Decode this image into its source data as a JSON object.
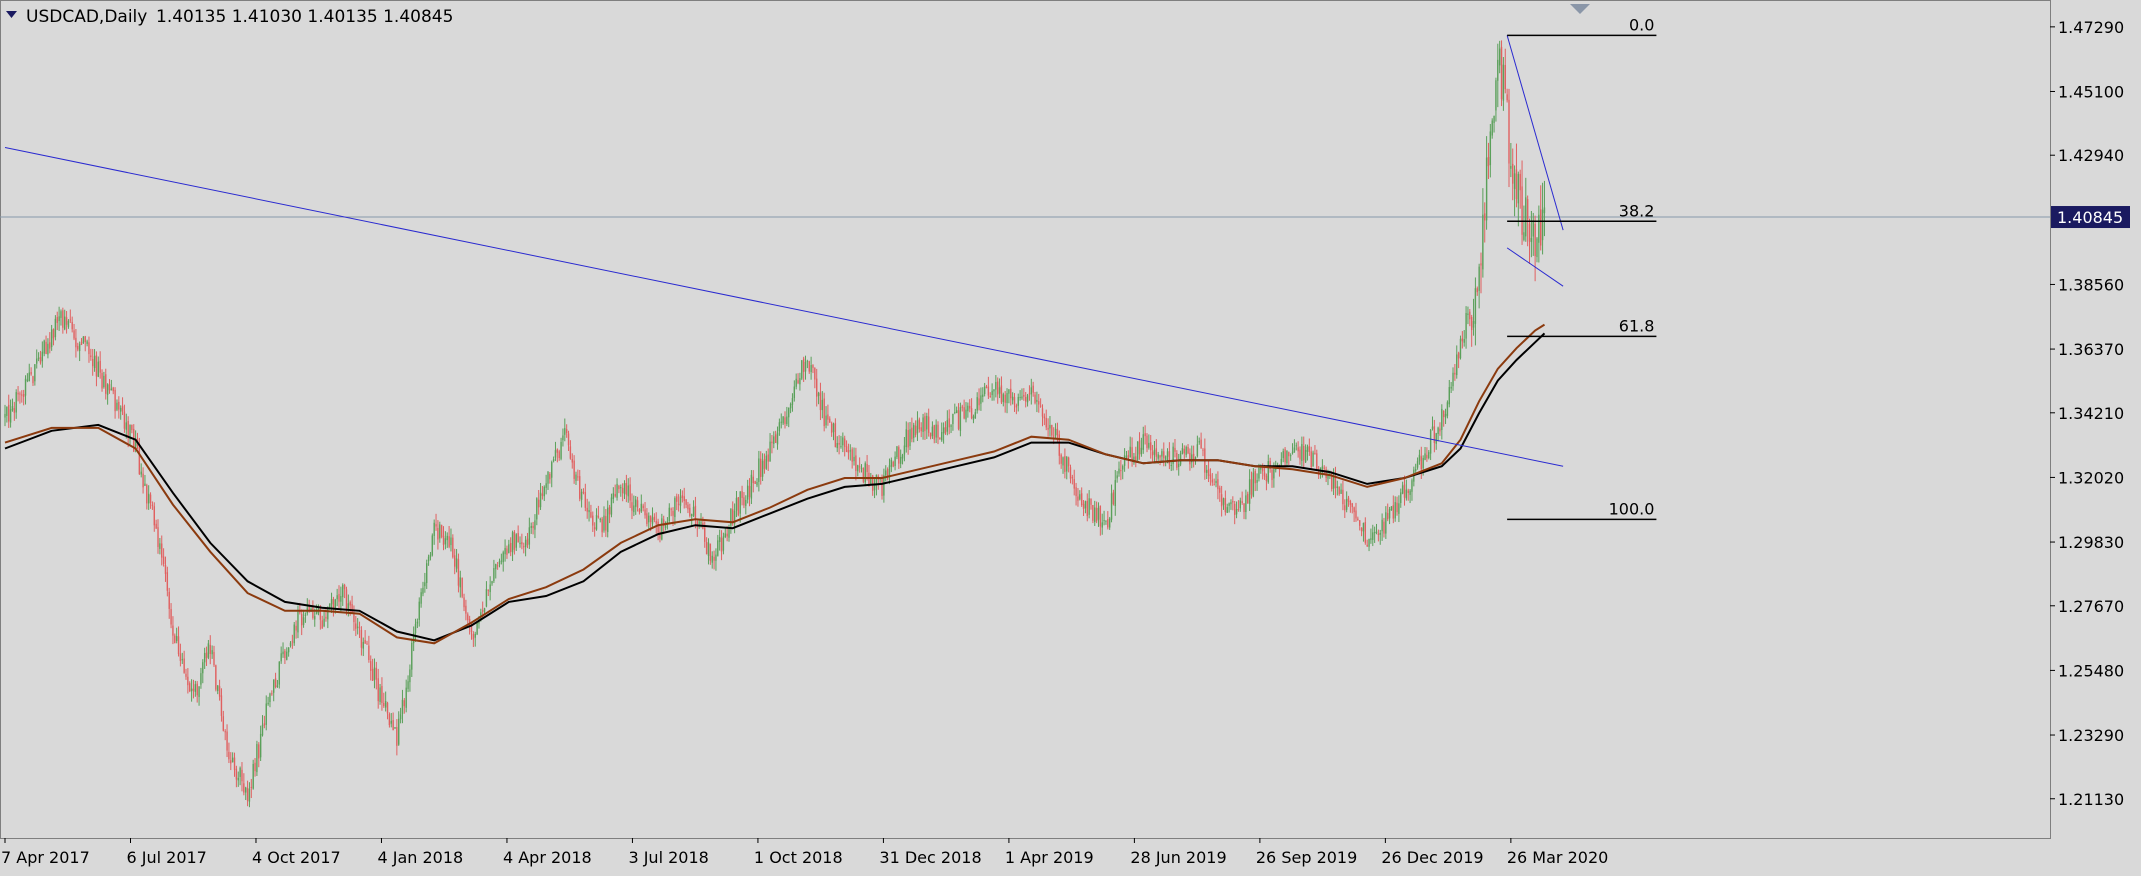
{
  "header": {
    "symbol": "USDCAD,Daily",
    "ohlc": "1.40135 1.41030 1.40135 1.40845"
  },
  "colors": {
    "background": "#d9d9d9",
    "bull": "#5aa05a",
    "bear": "#e06060",
    "ma_fast": "#000000",
    "ma_slow": "#8b3a0e",
    "trendline": "#2a2ad0",
    "fib_line": "#000000",
    "price_line": "#8899aa",
    "price_tag_bg": "#1a1a60",
    "price_tag_text": "#ffffff"
  },
  "current_price": {
    "value": 1.40845,
    "label": "1.40845"
  },
  "chart_data": {
    "type": "candlestick",
    "grid": false,
    "y_axis": {
      "range": [
        1.198,
        1.482
      ],
      "ticks": [
        "1.47290",
        "1.45100",
        "1.42940",
        "1.40845",
        "1.38560",
        "1.36370",
        "1.34210",
        "1.32020",
        "1.29830",
        "1.27670",
        "1.25480",
        "1.23290",
        "1.21130"
      ]
    },
    "x_axis": {
      "labels": [
        "7 Apr 2017",
        "6 Jul 2017",
        "4 Oct 2017",
        "4 Jan 2018",
        "4 Apr 2018",
        "3 Jul 2018",
        "1 Oct 2018",
        "31 Dec 2018",
        "1 Apr 2019",
        "28 Jun 2019",
        "26 Sep 2019",
        "26 Dec 2019",
        "26 Mar 2020"
      ]
    },
    "price_path": [
      [
        0,
        1.34
      ],
      [
        3,
        1.355
      ],
      [
        6,
        1.375
      ],
      [
        9,
        1.362
      ],
      [
        12,
        1.345
      ],
      [
        14,
        1.33
      ],
      [
        16,
        1.305
      ],
      [
        18,
        1.27
      ],
      [
        20,
        1.245
      ],
      [
        22,
        1.262
      ],
      [
        24,
        1.228
      ],
      [
        26,
        1.212
      ],
      [
        28,
        1.24
      ],
      [
        30,
        1.262
      ],
      [
        32,
        1.275
      ],
      [
        34,
        1.272
      ],
      [
        36,
        1.282
      ],
      [
        38,
        1.268
      ],
      [
        40,
        1.248
      ],
      [
        42,
        1.232
      ],
      [
        44,
        1.268
      ],
      [
        46,
        1.305
      ],
      [
        48,
        1.295
      ],
      [
        50,
        1.265
      ],
      [
        52,
        1.285
      ],
      [
        54,
        1.298
      ],
      [
        56,
        1.3
      ],
      [
        58,
        1.32
      ],
      [
        60,
        1.335
      ],
      [
        62,
        1.312
      ],
      [
        64,
        1.302
      ],
      [
        66,
        1.318
      ],
      [
        68,
        1.308
      ],
      [
        70,
        1.302
      ],
      [
        72,
        1.313
      ],
      [
        74,
        1.306
      ],
      [
        76,
        1.292
      ],
      [
        78,
        1.308
      ],
      [
        80,
        1.318
      ],
      [
        82,
        1.33
      ],
      [
        84,
        1.345
      ],
      [
        86,
        1.362
      ],
      [
        88,
        1.338
      ],
      [
        90,
        1.33
      ],
      [
        92,
        1.322
      ],
      [
        94,
        1.316
      ],
      [
        96,
        1.33
      ],
      [
        98,
        1.34
      ],
      [
        100,
        1.335
      ],
      [
        102,
        1.34
      ],
      [
        104,
        1.345
      ],
      [
        106,
        1.352
      ],
      [
        108,
        1.345
      ],
      [
        110,
        1.35
      ],
      [
        112,
        1.338
      ],
      [
        114,
        1.322
      ],
      [
        116,
        1.31
      ],
      [
        118,
        1.305
      ],
      [
        120,
        1.326
      ],
      [
        122,
        1.332
      ],
      [
        124,
        1.328
      ],
      [
        126,
        1.326
      ],
      [
        128,
        1.33
      ],
      [
        130,
        1.315
      ],
      [
        132,
        1.307
      ],
      [
        134,
        1.32
      ],
      [
        136,
        1.323
      ],
      [
        138,
        1.33
      ],
      [
        140,
        1.326
      ],
      [
        142,
        1.32
      ],
      [
        144,
        1.31
      ],
      [
        146,
        1.3
      ],
      [
        148,
        1.305
      ],
      [
        150,
        1.315
      ],
      [
        152,
        1.328
      ],
      [
        154,
        1.34
      ],
      [
        156,
        1.365
      ],
      [
        158,
        1.39
      ],
      [
        159,
        1.43
      ],
      [
        160,
        1.465
      ],
      [
        161,
        1.44
      ],
      [
        162,
        1.42
      ],
      [
        163,
        1.408
      ],
      [
        164,
        1.395
      ],
      [
        165,
        1.408
      ]
    ],
    "moving_averages": [
      {
        "color": "#000000",
        "points": [
          [
            0,
            1.33
          ],
          [
            5,
            1.336
          ],
          [
            10,
            1.338
          ],
          [
            14,
            1.333
          ],
          [
            18,
            1.315
          ],
          [
            22,
            1.298
          ],
          [
            26,
            1.285
          ],
          [
            30,
            1.278
          ],
          [
            34,
            1.276
          ],
          [
            38,
            1.275
          ],
          [
            42,
            1.268
          ],
          [
            46,
            1.265
          ],
          [
            50,
            1.27
          ],
          [
            54,
            1.278
          ],
          [
            58,
            1.28
          ],
          [
            62,
            1.285
          ],
          [
            66,
            1.295
          ],
          [
            70,
            1.301
          ],
          [
            74,
            1.304
          ],
          [
            78,
            1.303
          ],
          [
            82,
            1.308
          ],
          [
            86,
            1.313
          ],
          [
            90,
            1.317
          ],
          [
            94,
            1.318
          ],
          [
            98,
            1.321
          ],
          [
            102,
            1.324
          ],
          [
            106,
            1.327
          ],
          [
            110,
            1.332
          ],
          [
            114,
            1.332
          ],
          [
            118,
            1.328
          ],
          [
            122,
            1.325
          ],
          [
            126,
            1.326
          ],
          [
            130,
            1.326
          ],
          [
            134,
            1.324
          ],
          [
            138,
            1.324
          ],
          [
            142,
            1.322
          ],
          [
            146,
            1.318
          ],
          [
            150,
            1.32
          ],
          [
            154,
            1.324
          ],
          [
            156,
            1.33
          ],
          [
            158,
            1.342
          ],
          [
            160,
            1.353
          ],
          [
            162,
            1.36
          ],
          [
            164,
            1.366
          ],
          [
            165,
            1.369
          ]
        ]
      },
      {
        "color": "#8b3a0e",
        "points": [
          [
            0,
            1.332
          ],
          [
            5,
            1.337
          ],
          [
            10,
            1.337
          ],
          [
            14,
            1.33
          ],
          [
            18,
            1.311
          ],
          [
            22,
            1.295
          ],
          [
            26,
            1.281
          ],
          [
            30,
            1.275
          ],
          [
            34,
            1.275
          ],
          [
            38,
            1.274
          ],
          [
            42,
            1.266
          ],
          [
            46,
            1.264
          ],
          [
            50,
            1.271
          ],
          [
            54,
            1.279
          ],
          [
            58,
            1.283
          ],
          [
            62,
            1.289
          ],
          [
            66,
            1.298
          ],
          [
            70,
            1.304
          ],
          [
            74,
            1.306
          ],
          [
            78,
            1.305
          ],
          [
            82,
            1.31
          ],
          [
            86,
            1.316
          ],
          [
            90,
            1.32
          ],
          [
            94,
            1.32
          ],
          [
            98,
            1.323
          ],
          [
            102,
            1.326
          ],
          [
            106,
            1.329
          ],
          [
            110,
            1.334
          ],
          [
            114,
            1.333
          ],
          [
            118,
            1.328
          ],
          [
            122,
            1.325
          ],
          [
            126,
            1.326
          ],
          [
            130,
            1.326
          ],
          [
            134,
            1.324
          ],
          [
            138,
            1.323
          ],
          [
            142,
            1.321
          ],
          [
            146,
            1.317
          ],
          [
            150,
            1.32
          ],
          [
            154,
            1.325
          ],
          [
            156,
            1.333
          ],
          [
            158,
            1.346
          ],
          [
            160,
            1.357
          ],
          [
            162,
            1.364
          ],
          [
            164,
            1.37
          ],
          [
            165,
            1.372
          ]
        ]
      }
    ],
    "trendlines": [
      {
        "from": [
          0,
          1.432
        ],
        "to": [
          167,
          1.324
        ]
      },
      {
        "from": [
          161,
          1.47
        ],
        "to": [
          167,
          1.404
        ]
      },
      {
        "from": [
          161,
          1.398
        ],
        "to": [
          167,
          1.385
        ]
      }
    ],
    "fibonacci": {
      "x_range": [
        161,
        177
      ],
      "levels": [
        {
          "label": "0.0",
          "price": 1.47
        },
        {
          "label": "38.2",
          "price": 1.407
        },
        {
          "label": "61.8",
          "price": 1.368
        },
        {
          "label": "100.0",
          "price": 1.306
        }
      ]
    }
  }
}
